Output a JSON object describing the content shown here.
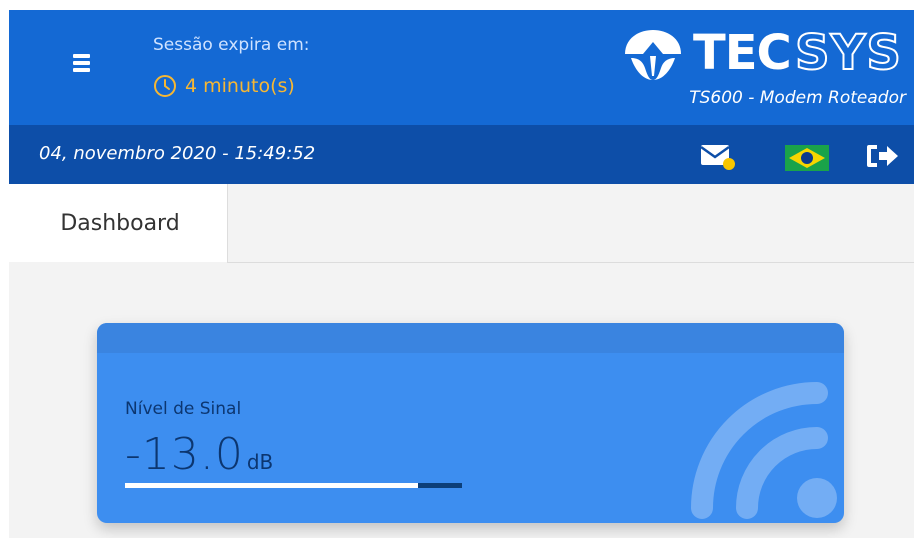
{
  "header": {
    "session_label": "Sessão expira em:",
    "session_timer": "4 minuto(s)",
    "logo_brand": "TECSYS",
    "subtitle": "TS600 - Modem Roteador"
  },
  "datebar": {
    "datetime": "04, novembro 2020 - 15:49:52"
  },
  "tabs": [
    {
      "label": "Dashboard",
      "active": true
    }
  ],
  "card": {
    "label": "Nível de Sinal",
    "value": "-13.0",
    "unit": "dB",
    "progress_fraction": 0.87
  },
  "colors": {
    "header_bg": "#1469d4",
    "datebar_bg": "#0d4ea8",
    "timer": "#f6b733",
    "card_bg": "#3d8ef0",
    "card_text": "#0c3670"
  },
  "icons": [
    "menu-icon",
    "clock-icon",
    "mail-icon",
    "brazil-flag-icon",
    "logout-icon",
    "wifi-icon"
  ]
}
